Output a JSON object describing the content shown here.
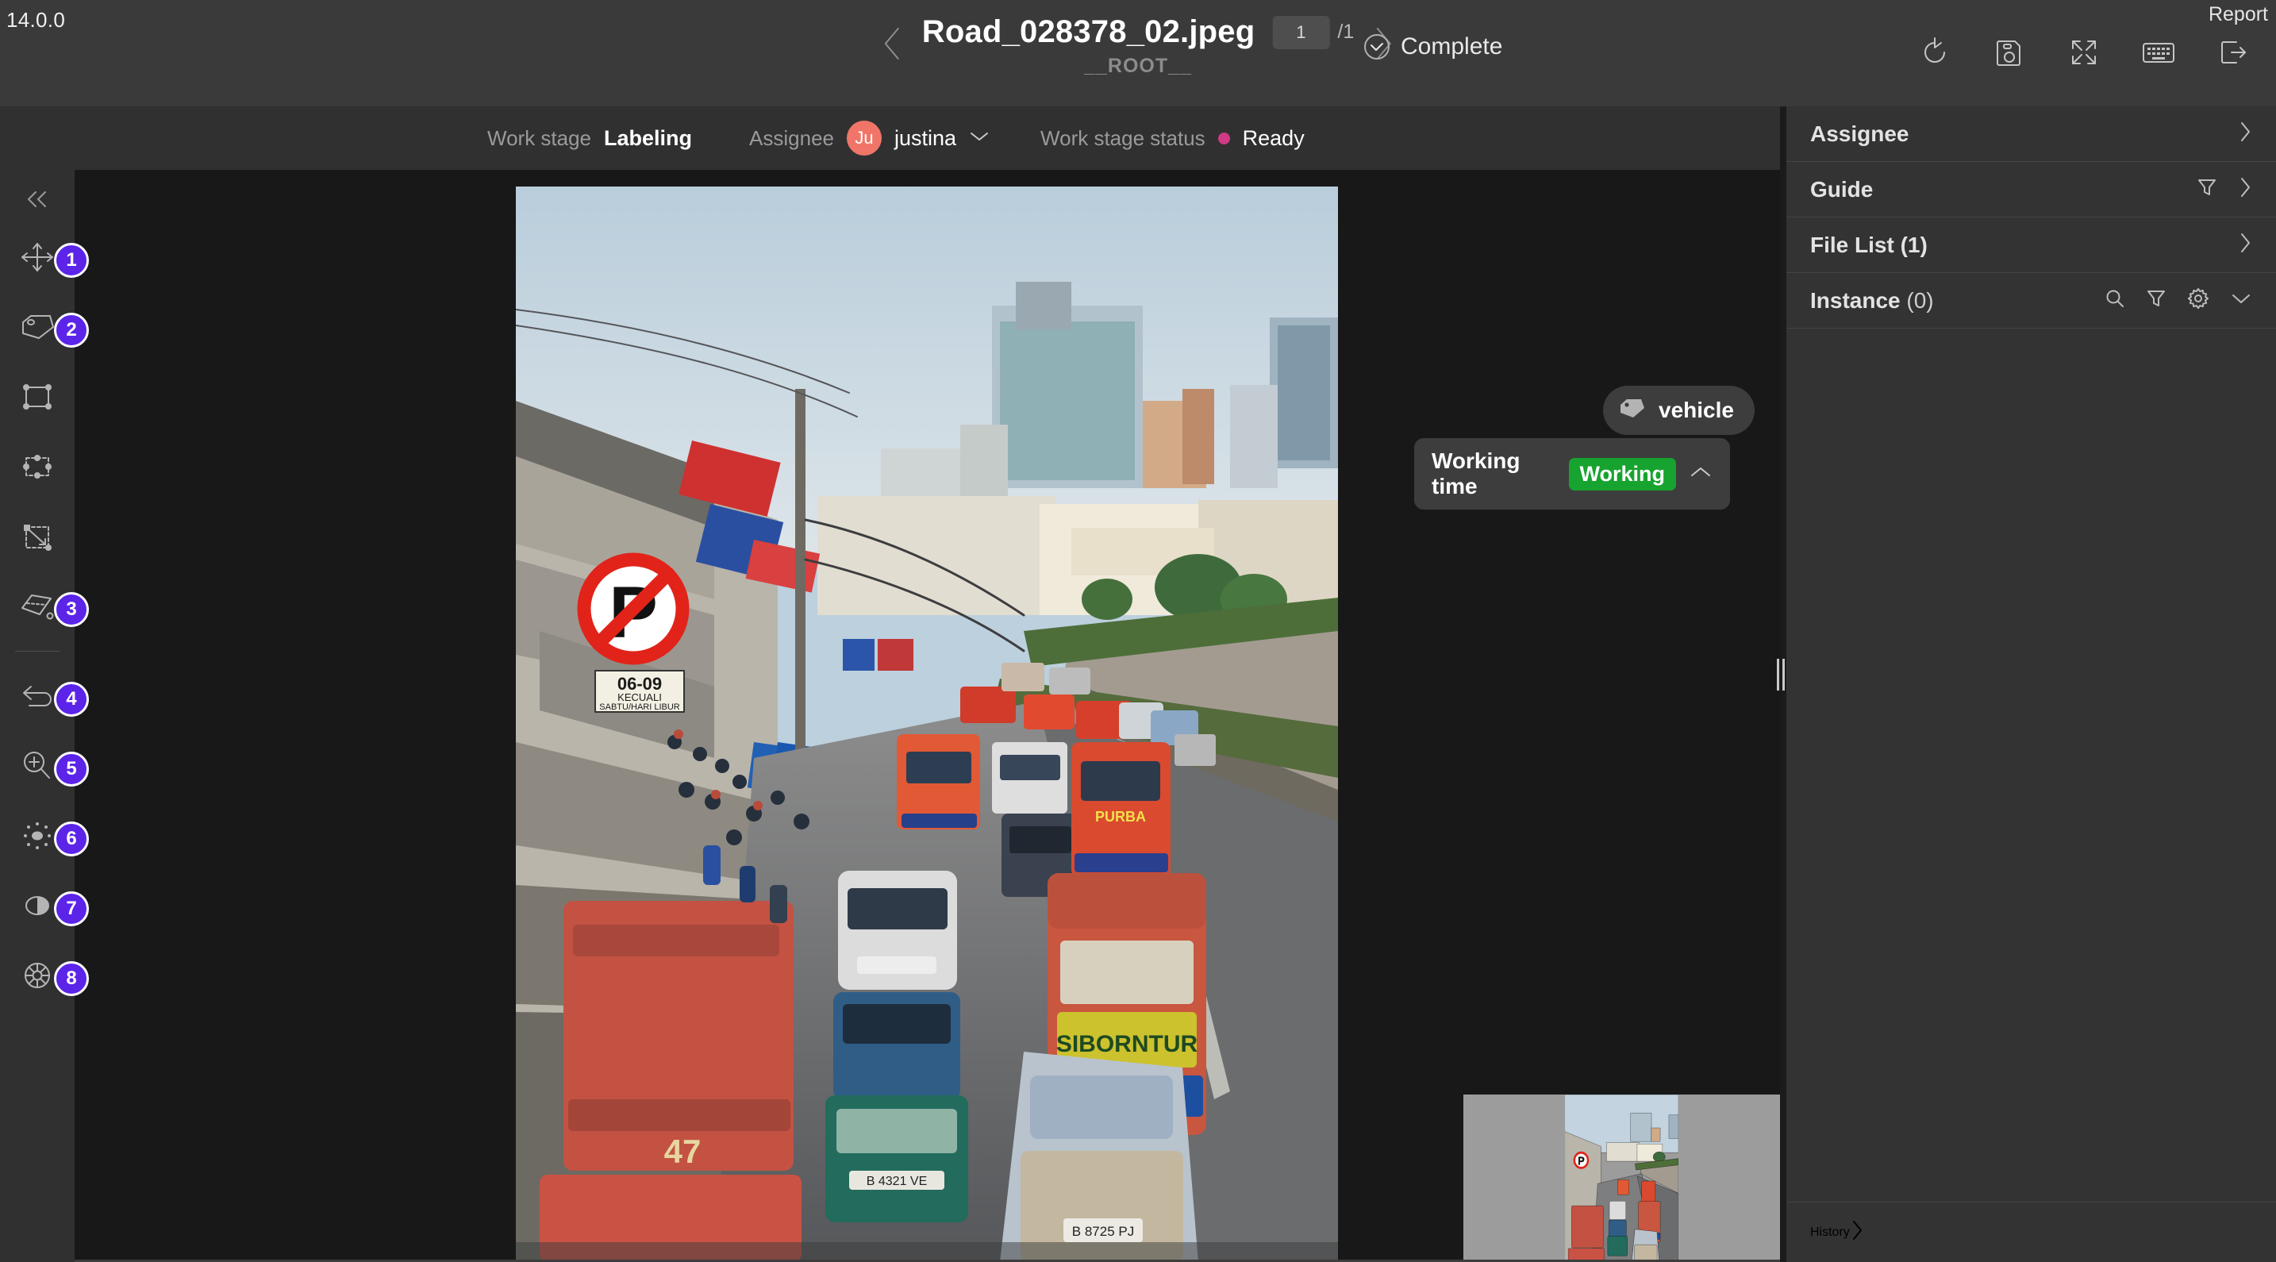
{
  "app": {
    "version": "14.0.0",
    "report_label": "Report"
  },
  "header": {
    "prev_icon": "chevron-left-icon",
    "next_icon": "chevron-right-icon",
    "file_title": "Road_028378_02.jpeg",
    "page_current": "1",
    "page_total": "/1",
    "root_label": "__ROOT__",
    "complete_label": "Complete",
    "complete_icon": "circle-check-icon",
    "actions": [
      {
        "name": "reset-icon",
        "title": "Reset"
      },
      {
        "name": "save-icon",
        "title": "Save"
      },
      {
        "name": "fullscreen-icon",
        "title": "Fullscreen"
      },
      {
        "name": "keyboard-icon",
        "title": "Shortcuts"
      },
      {
        "name": "exit-icon",
        "title": "Exit"
      }
    ]
  },
  "subbar": {
    "work_stage_label": "Work stage",
    "work_stage_value": "Labeling",
    "assignee_label": "Assignee",
    "assignee_initials": "Ju",
    "assignee_name": "justina",
    "assignee_chevron": "chevron-down-icon",
    "status_label": "Work stage status",
    "status_value": "Ready",
    "status_color": "#cf3a87",
    "avatar_color": "#f07568"
  },
  "toolbar": {
    "collapse_icon": "double-chevron-left-icon",
    "badge_color": "#5b24e8",
    "tools": [
      {
        "name": "move-tool",
        "icon": "move-arrows-icon",
        "badge": "1"
      },
      {
        "name": "tag-tool",
        "icon": "tag-icon",
        "badge": "2"
      },
      {
        "name": "bounding-box-tool",
        "icon": "bounding-box-icon",
        "badge": ""
      },
      {
        "name": "select-box-tool",
        "icon": "dashed-box-handles-icon",
        "badge": ""
      },
      {
        "name": "transform-tool",
        "icon": "drag-resize-icon",
        "badge": ""
      },
      {
        "name": "polygon-tool",
        "icon": "polygon-icon",
        "badge": "3"
      },
      {
        "name": "undo-tool",
        "icon": "undo-arrow-icon",
        "badge": "4"
      },
      {
        "name": "zoom-tool",
        "icon": "zoom-in-icon",
        "badge": "5"
      },
      {
        "name": "brightness-tool",
        "icon": "brightness-icon",
        "badge": "6"
      },
      {
        "name": "contrast-tool",
        "icon": "contrast-icon",
        "badge": "7"
      },
      {
        "name": "saturation-tool",
        "icon": "color-wheel-icon",
        "badge": "8"
      }
    ]
  },
  "canvas": {
    "tag_chip": {
      "icon": "tag-icon",
      "label": "vehicle"
    },
    "working_time": {
      "label": "Working time",
      "badge": "Working",
      "badge_color": "#17a32f",
      "chevron": "chevron-up-icon"
    },
    "minimap_name": "minimap-thumbnail"
  },
  "right_panel": {
    "rows": [
      {
        "title": "Assignee",
        "count": "",
        "icons": [
          "chevron-right-icon"
        ]
      },
      {
        "title": "Guide",
        "count": "",
        "icons": [
          "filter-icon",
          "chevron-right-icon"
        ]
      },
      {
        "title": "File List",
        "count": "(1)",
        "icons": [
          "chevron-right-icon"
        ]
      },
      {
        "title": "Instance",
        "count": "(0)",
        "icons": [
          "search-icon",
          "filter-icon",
          "gear-icon",
          "chevron-down-icon"
        ]
      }
    ],
    "history": {
      "title": "History",
      "icon": "chevron-right-icon"
    }
  }
}
